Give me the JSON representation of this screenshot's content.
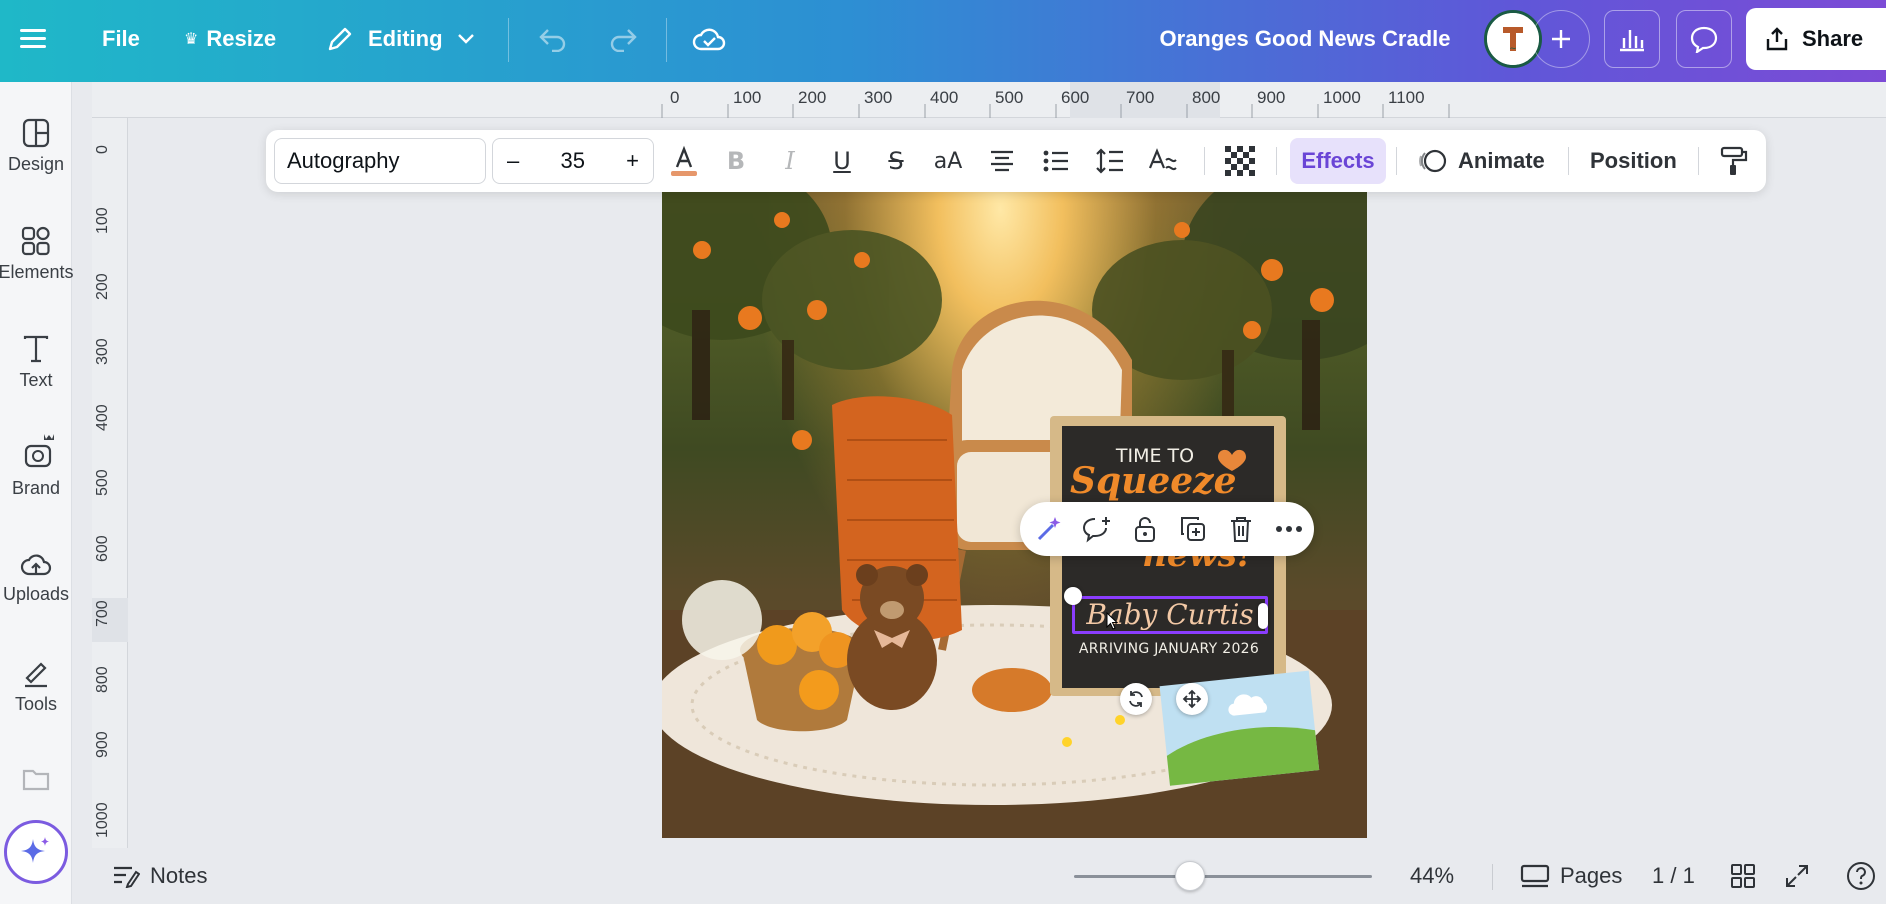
{
  "topbar": {
    "menu_icon": "hamburger-menu-icon",
    "file_label": "File",
    "resize_label": "Resize",
    "editing_label": "Editing",
    "doc_title": "Oranges Good News Cradle",
    "share_label": "Share"
  },
  "sidebar": {
    "items": [
      {
        "label": "Design",
        "icon": "design-icon"
      },
      {
        "label": "Elements",
        "icon": "elements-icon"
      },
      {
        "label": "Text",
        "icon": "text-icon"
      },
      {
        "label": "Brand",
        "icon": "brand-icon"
      },
      {
        "label": "Uploads",
        "icon": "uploads-icon"
      },
      {
        "label": "Tools",
        "icon": "tools-icon"
      }
    ]
  },
  "ruler": {
    "top": [
      "0",
      "100",
      "200",
      "300",
      "400",
      "500",
      "600",
      "700",
      "800",
      "900",
      "1000",
      "1100"
    ],
    "left": [
      "0",
      "100",
      "200",
      "300",
      "400",
      "500",
      "600",
      "700",
      "800",
      "900",
      "1000"
    ]
  },
  "format_toolbar": {
    "font": "Autography",
    "minus": "–",
    "size": "35",
    "plus": "+",
    "effects_label": "Effects",
    "animate_label": "Animate",
    "position_label": "Position"
  },
  "design": {
    "board_line1": "TIME TO",
    "board_line2": "Squeeze",
    "board_line3": "news!",
    "board_name": "Baby Curtis",
    "board_arriving": "ARRIVING JANUARY 2026"
  },
  "bottombar": {
    "notes_label": "Notes",
    "zoom": "44%",
    "zoom_fraction": 0.39,
    "pages_label": "Pages",
    "page_count": "1 / 1"
  },
  "colors": {
    "accent": "#7c4bd6",
    "effects_bg": "#e7e1fb",
    "selection": "#8b3dff",
    "orange": "#e0782a"
  }
}
